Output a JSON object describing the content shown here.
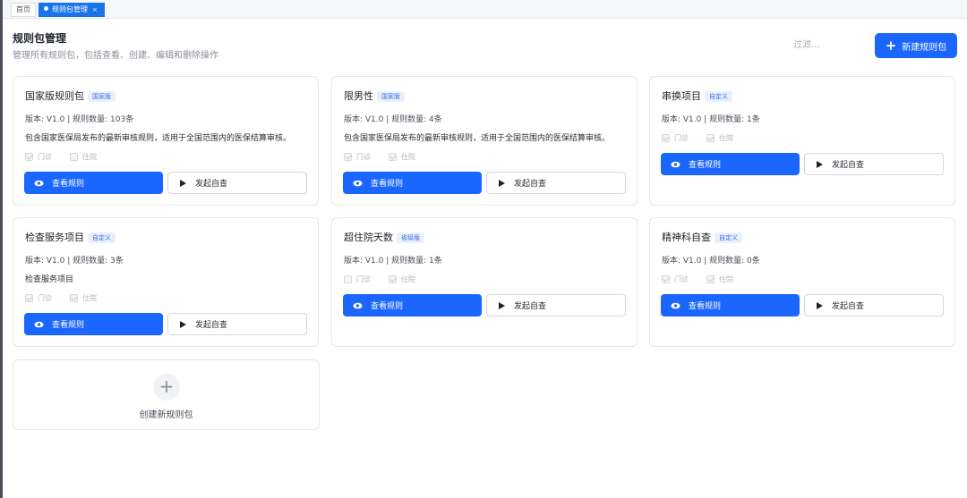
{
  "tabs": {
    "home": "首页",
    "active": "规则包管理",
    "close": "×"
  },
  "header": {
    "title": "规则包管理",
    "description": "管理所有规则包，包括查看、创建、编辑和删除操作",
    "filter_placeholder": "过滤...",
    "new_button": "新建规则包"
  },
  "labels": {
    "outpatient": "门诊",
    "inpatient": "住院",
    "view": "查看规则",
    "self_check": "发起自查"
  },
  "cards": [
    {
      "title": "国家版规则包",
      "badge": "国家版",
      "meta": "版本: V1.0 | 规则数量: 103条",
      "desc": "包含国家医保局发布的最新审核规则，适用于全国范围内的医保结算审核。"
    },
    {
      "title": "限男性",
      "badge": "国家版",
      "meta": "版本: V1.0 | 规则数量: 4条",
      "desc": "包含国家医保局发布的最新审核规则，适用于全国范围内的医保结算审核。"
    },
    {
      "title": "串换项目",
      "badge": "自定义",
      "meta": "版本: V1.0 | 规则数量: 1条",
      "desc": ""
    },
    {
      "title": "检查服务项目",
      "badge": "自定义",
      "meta": "版本: V1.0 | 规则数量: 3条",
      "desc": "检查服务项目"
    },
    {
      "title": "超住院天数",
      "badge": "省级版",
      "meta": "版本: V1.0 | 规则数量: 1条",
      "desc": ""
    },
    {
      "title": "精神科自查",
      "badge": "自定义",
      "meta": "版本: V1.0 | 规则数量: 0条",
      "desc": ""
    }
  ],
  "create_card": {
    "plus": "+",
    "label": "创建新规则包"
  },
  "colors": {
    "primary": "#1a66ff",
    "badge_bg": "#e8f0fe",
    "badge_text": "#3a6fe0"
  }
}
